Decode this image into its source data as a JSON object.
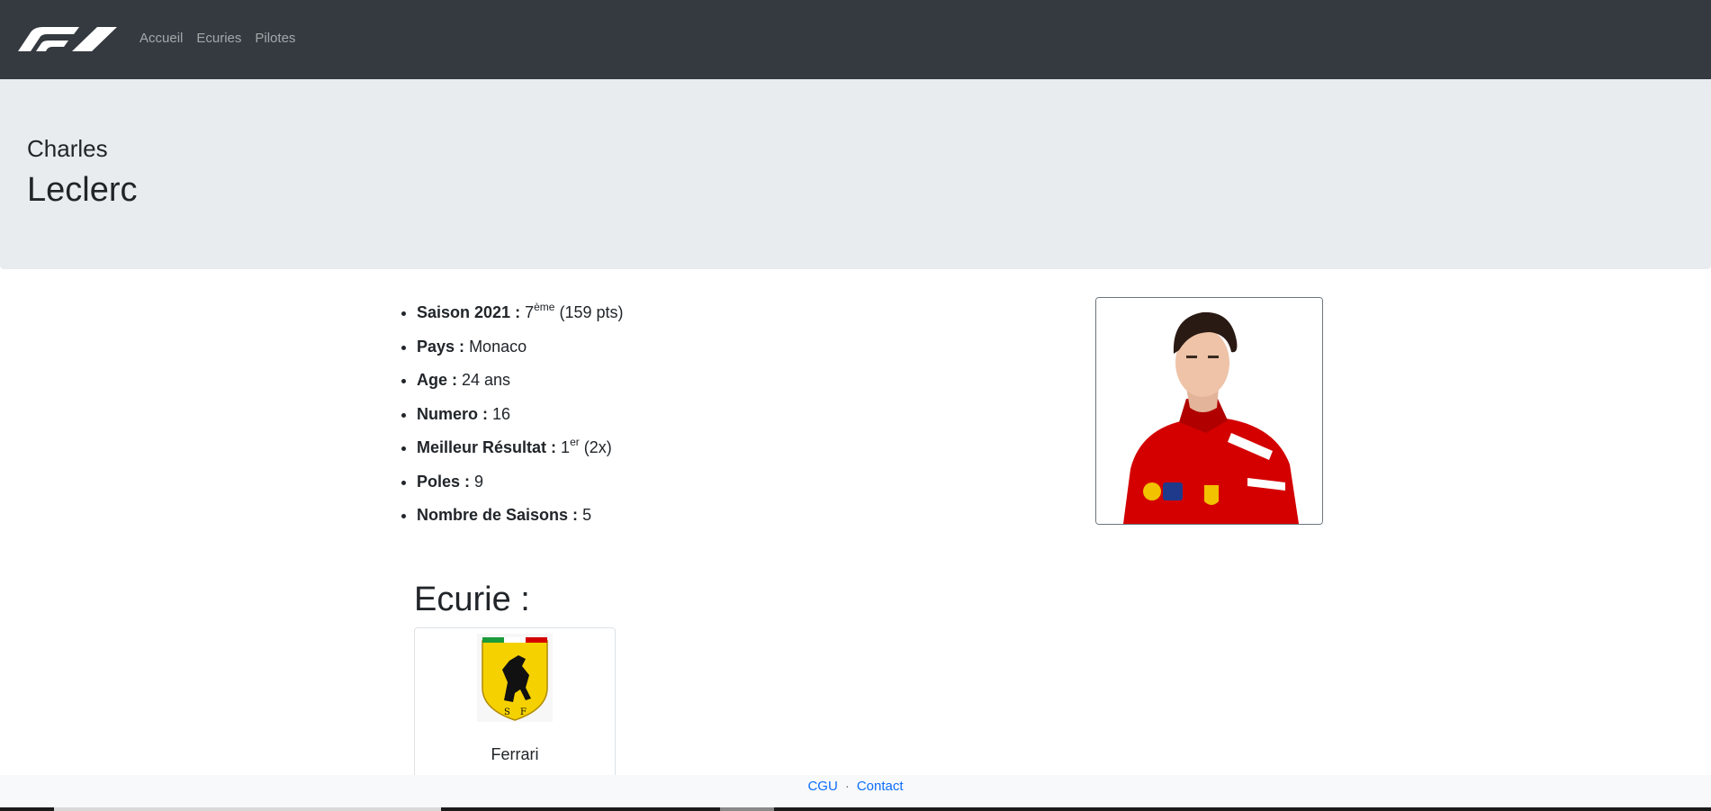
{
  "nav": {
    "links": [
      "Accueil",
      "Ecuries",
      "Pilotes"
    ]
  },
  "driver": {
    "first_name": "Charles",
    "last_name": "Leclerc"
  },
  "stats": [
    {
      "label": "Saison 2021 :",
      "value": "7",
      "sup": "ème",
      "after": "(159 pts)"
    },
    {
      "label": "Pays :",
      "value": "Monaco"
    },
    {
      "label": "Age :",
      "value": "24 ans"
    },
    {
      "label": "Numero :",
      "value": "16"
    },
    {
      "label": "Meilleur Résultat :",
      "value": "1",
      "sup": "er",
      "after": "(2x)"
    },
    {
      "label": "Poles :",
      "value": "9"
    },
    {
      "label": "Nombre de Saisons :",
      "value": "5"
    }
  ],
  "team": {
    "heading": "Ecurie :",
    "name": "Ferrari",
    "logo_icon": "ferrari-shield-icon"
  },
  "footer": {
    "cgu": "CGU",
    "separator": "·",
    "contact": "Contact"
  },
  "colors": {
    "navbar": "#343a40",
    "jumbotron": "#e9ecef",
    "ferrari_red": "#d40000",
    "link": "#0d6efd"
  }
}
